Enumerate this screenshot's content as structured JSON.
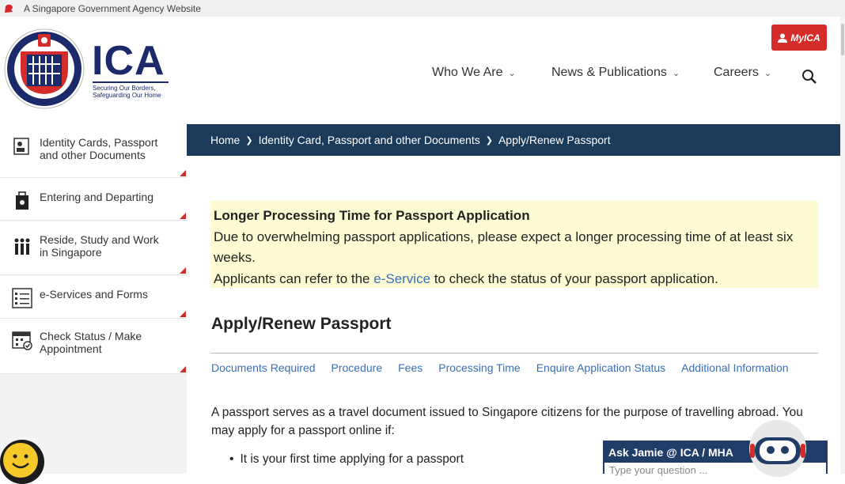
{
  "masthead": {
    "text": "A Singapore Government Agency Website",
    "icon": "lion-head-icon"
  },
  "brand": {
    "name": "ICA",
    "tagline_line1": "Securing Our Borders,",
    "tagline_line2": "Safeguarding Our Home",
    "colors": {
      "navy": "#1b2a6b",
      "red": "#d42b2b"
    }
  },
  "header": {
    "myica_label": "MyICA",
    "nav": [
      "Who We Are",
      "News & Publications",
      "Careers"
    ],
    "search_icon": "search-icon"
  },
  "sidebar": {
    "items": [
      {
        "label_line1": "Identity Cards, Passport",
        "label_line2": "and other Documents",
        "icon": "id-card-icon"
      },
      {
        "label_line1": "Entering and Departing",
        "label_line2": "",
        "icon": "luggage-icon"
      },
      {
        "label_line1": "Reside, Study and Work",
        "label_line2": "in Singapore",
        "icon": "people-icon"
      },
      {
        "label_line1": "e-Services and Forms",
        "label_line2": "",
        "icon": "form-list-icon"
      },
      {
        "label_line1": "Check Status / Make",
        "label_line2": "Appointment",
        "icon": "calendar-check-icon"
      }
    ]
  },
  "breadcrumb": [
    "Home",
    "Identity Card, Passport and other Documents",
    "Apply/Renew Passport"
  ],
  "notice": {
    "title": "Longer Processing Time for Passport Application",
    "line1": "Due to overwhelming passport applications, please expect a longer processing time of at least six",
    "line2": "weeks.",
    "line3_pre": "Applicants can refer to the ",
    "line3_link": "e-Service",
    "line3_post": " to check the status of your passport application."
  },
  "page": {
    "title": "Apply/Renew Passport",
    "tabs": [
      "Documents Required",
      "Procedure",
      "Fees",
      "Processing Time",
      "Enquire Application Status",
      "Additional Information"
    ],
    "para_line1": "A passport serves as a travel document issued to Singapore citizens for the purpose of travelling abroad. You",
    "para_line2": "may apply for a passport online if:",
    "bullet1": "It is your first time applying for a passport"
  },
  "chat": {
    "title": "Ask Jamie @ ICA / MHA",
    "placeholder": "Type your question ..."
  }
}
